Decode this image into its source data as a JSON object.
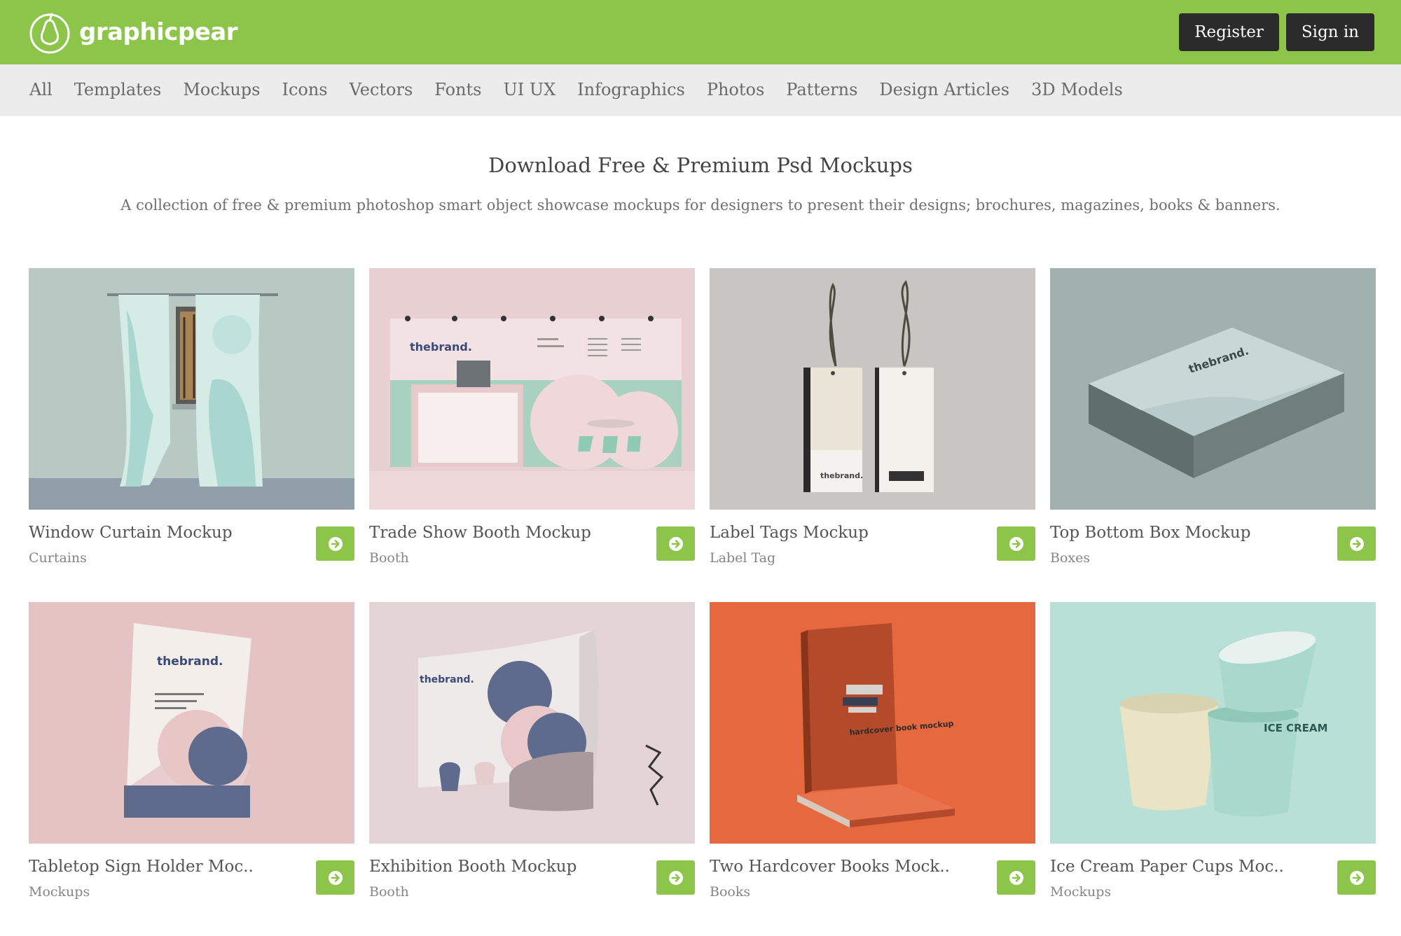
{
  "header": {
    "logo_text": "graphicpear",
    "register_label": "Register",
    "signin_label": "Sign in",
    "brand_color": "#8dc54b"
  },
  "nav": {
    "items": [
      "All",
      "Templates",
      "Mockups",
      "Icons",
      "Vectors",
      "Fonts",
      "UI UX",
      "Infographics",
      "Photos",
      "Patterns",
      "Design Articles",
      "3D Models"
    ]
  },
  "intro": {
    "title": "Download Free & Premium Psd Mockups",
    "subtitle": "A collection of free & premium photoshop smart object showcase mockups for designers to present their designs; brochures, magazines, books & banners."
  },
  "cards": [
    {
      "title": "Window Curtain Mockup",
      "category": "Curtains",
      "thumb_icon": "curtain-thumbnail"
    },
    {
      "title": "Trade Show Booth Mockup",
      "category": "Booth",
      "thumb_icon": "booth-thumbnail"
    },
    {
      "title": "Label Tags Mockup",
      "category": "Label Tag",
      "thumb_icon": "label-tags-thumbnail"
    },
    {
      "title": "Top Bottom Box Mockup",
      "category": "Boxes",
      "thumb_icon": "box-thumbnail"
    },
    {
      "title": "Tabletop Sign Holder Moc..",
      "category": "Mockups",
      "thumb_icon": "sign-holder-thumbnail"
    },
    {
      "title": "Exhibition Booth Mockup",
      "category": "Booth",
      "thumb_icon": "exhibition-thumbnail"
    },
    {
      "title": "Two Hardcover Books Mock..",
      "category": "Books",
      "thumb_icon": "books-thumbnail"
    },
    {
      "title": "Ice Cream Paper Cups Moc..",
      "category": "Mockups",
      "thumb_icon": "ice-cream-thumbnail"
    }
  ],
  "mockup_text": {
    "brand": "thebrand.",
    "book_cover": "hardcover book mockup",
    "cup": "ICE CREAM"
  }
}
